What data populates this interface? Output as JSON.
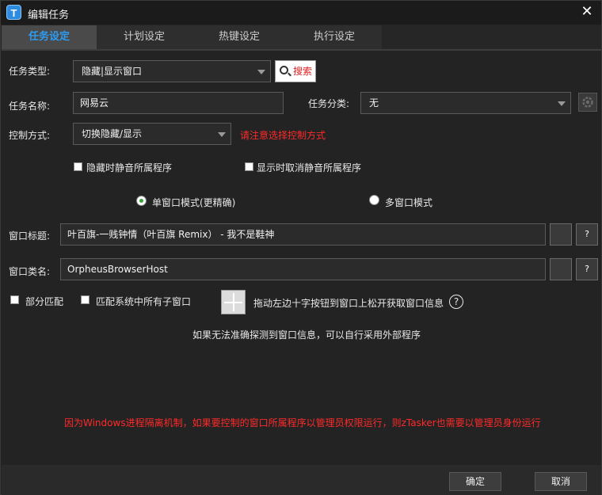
{
  "window": {
    "title": "编辑任务",
    "app_icon_letter": "T",
    "close_glyph": "✕"
  },
  "tabs": [
    {
      "label": "任务设定",
      "active": true
    },
    {
      "label": "计划设定",
      "active": false
    },
    {
      "label": "热键设定",
      "active": false
    },
    {
      "label": "执行设定",
      "active": false
    }
  ],
  "form": {
    "task_type_label": "任务类型:",
    "task_type_value": "隐藏|显示窗口",
    "search_label": "搜索",
    "task_name_label": "任务名称:",
    "task_name_value": "网易云",
    "task_category_label": "任务分类:",
    "task_category_value": "无",
    "control_mode_label": "控制方式:",
    "control_mode_value": "切换隐藏/显示",
    "control_mode_warning": "请注意选择控制方式",
    "mute_on_hide_label": "隐藏时静音所属程序",
    "unmute_on_show_label": "显示时取消静音所属程序",
    "single_window_label": "单窗口模式(更精确)",
    "multi_window_label": "多窗口模式",
    "window_title_label": "窗口标题:",
    "window_title_value": "叶百旗-一贱钟情（叶百旗 Remix） - 我不是鞋神",
    "window_class_label": "窗口类名:",
    "window_class_value": "OrpheusBrowserHost",
    "help_glyph": "?",
    "partial_match_label": "部分匹配",
    "match_children_label": "匹配系统中所有子窗口",
    "drag_hint": "拖动左边十字按钮到窗口上松开获取窗口信息",
    "fallback_hint": "如果无法准确探测到窗口信息，可以自行采用外部程序",
    "admin_warning": "因为Windows进程隔离机制，如果要控制的窗口所属程序以管理员权限运行，则zTasker也需要以管理员身份运行"
  },
  "footer": {
    "ok_label": "确定",
    "cancel_label": "取消"
  },
  "colors": {
    "accent_tab": "#2f9bf0",
    "warning_red": "#ff2a2a",
    "radio_selected": "#3aa33a",
    "background": "#232323"
  },
  "icons": [
    "app-logo-icon",
    "close-icon",
    "search-icon",
    "gear-icon",
    "crosshair-icon",
    "help-icon"
  ]
}
